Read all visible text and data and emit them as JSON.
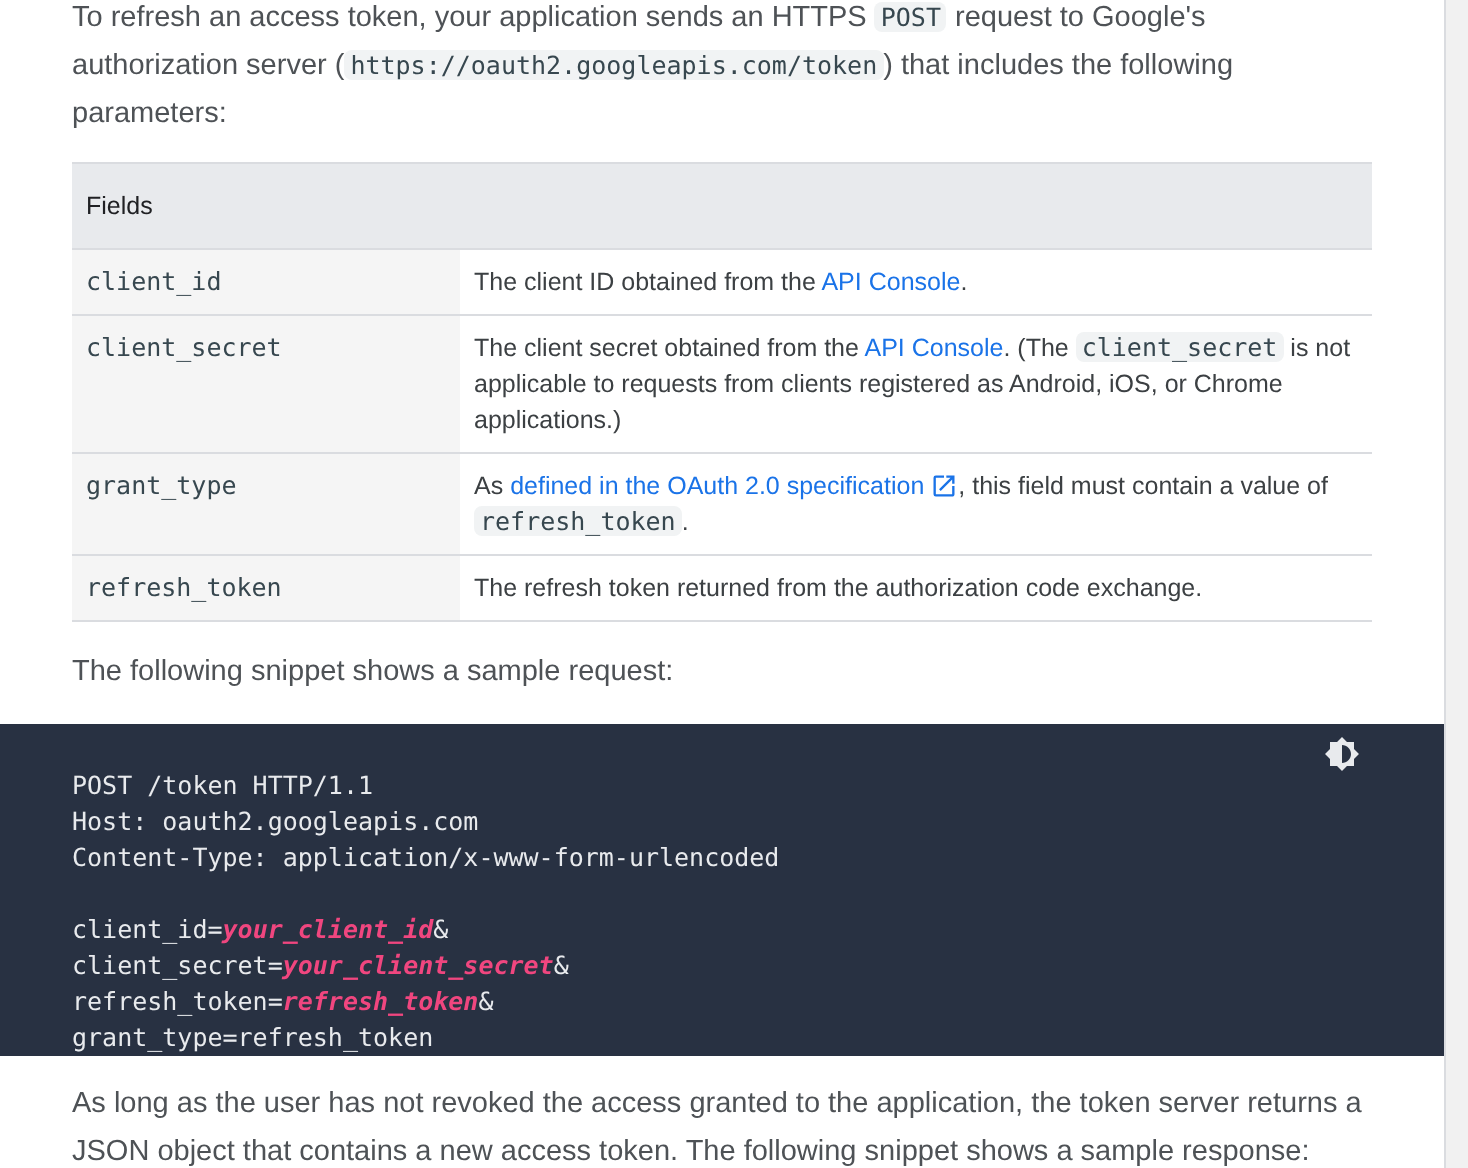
{
  "intro": [
    {
      "kind": "text",
      "text": "To refresh an access token, your application sends an HTTPS "
    },
    {
      "kind": "code",
      "text": "POST"
    },
    {
      "kind": "text",
      "text": " request to Google's authorization server ("
    },
    {
      "kind": "code",
      "text": "https://oauth2.googleapis.com/token"
    },
    {
      "kind": "text",
      "text": ") that includes the following parameters:"
    }
  ],
  "table": {
    "header": "Fields",
    "rows": [
      {
        "field": "client_id",
        "description": [
          {
            "kind": "text",
            "text": "The client ID obtained from the "
          },
          {
            "kind": "link",
            "text": "API Console"
          },
          {
            "kind": "text",
            "text": "."
          }
        ]
      },
      {
        "field": "client_secret",
        "description": [
          {
            "kind": "text",
            "text": "The client secret obtained from the "
          },
          {
            "kind": "link",
            "text": "API Console"
          },
          {
            "kind": "text",
            "text": ". (The "
          },
          {
            "kind": "code",
            "text": "client_secret"
          },
          {
            "kind": "text",
            "text": " is not applicable to requests from clients registered as Android, iOS, or Chrome applications.)"
          }
        ]
      },
      {
        "field": "grant_type",
        "description": [
          {
            "kind": "text",
            "text": "As "
          },
          {
            "kind": "extlink",
            "text": "defined in the OAuth 2.0 specification"
          },
          {
            "kind": "text",
            "text": ", this field must contain a value of "
          },
          {
            "kind": "code",
            "text": "refresh_token"
          },
          {
            "kind": "text",
            "text": "."
          }
        ]
      },
      {
        "field": "refresh_token",
        "description": [
          {
            "kind": "text",
            "text": "The refresh token returned from the authorization code exchange."
          }
        ]
      }
    ]
  },
  "snippet_intro": "The following snippet shows a sample request:",
  "code": {
    "blocks": [
      [
        [
          {
            "kind": "plain",
            "text": "POST /token HTTP/1.1"
          }
        ],
        [
          {
            "kind": "plain",
            "text": "Host: oauth2.googleapis.com"
          }
        ],
        [
          {
            "kind": "plain",
            "text": "Content-Type: application/x-www-form-urlencoded"
          }
        ]
      ],
      [
        [
          {
            "kind": "plain",
            "text": "client_id="
          },
          {
            "kind": "var",
            "text": "your_client_id"
          },
          {
            "kind": "plain",
            "text": "&"
          }
        ],
        [
          {
            "kind": "plain",
            "text": "client_secret="
          },
          {
            "kind": "var",
            "text": "your_client_secret"
          },
          {
            "kind": "plain",
            "text": "&"
          }
        ],
        [
          {
            "kind": "plain",
            "text": "refresh_token="
          },
          {
            "kind": "var",
            "text": "refresh_token"
          },
          {
            "kind": "plain",
            "text": "&"
          }
        ],
        [
          {
            "kind": "plain",
            "text": "grant_type=refresh_token"
          }
        ]
      ]
    ]
  },
  "outro": "As long as the user has not revoked the access granted to the application, the token server returns a JSON object that contains a new access token. The following snippet shows a sample response:"
}
